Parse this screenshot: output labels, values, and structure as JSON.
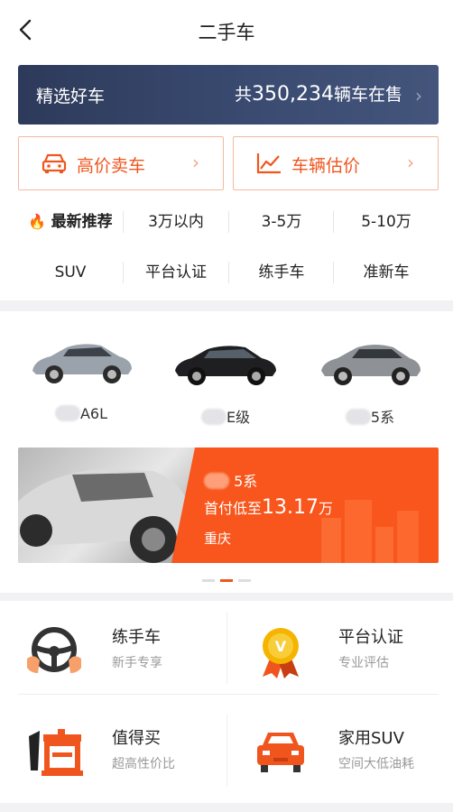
{
  "header": {
    "title": "二手车"
  },
  "banner": {
    "left": "精选好车",
    "prefix": "共",
    "count": "350,234",
    "suffix": "辆车在售"
  },
  "actions": [
    {
      "label": "高价卖车",
      "icon": "car-front-icon"
    },
    {
      "label": "车辆估价",
      "icon": "trend-chart-icon"
    }
  ],
  "filters": {
    "row1": [
      "最新推荐",
      "3万以内",
      "3-5万",
      "5-10万"
    ],
    "row2": [
      "SUV",
      "平台认证",
      "练手车",
      "准新车"
    ]
  },
  "cars": [
    {
      "name": "A6L",
      "icon": "sports-coupe-icon",
      "color": "#9aa3ab"
    },
    {
      "name": "E级",
      "icon": "sedan-icon",
      "color": "#1f1f22"
    },
    {
      "name": "5系",
      "icon": "coupe-icon",
      "color": "#8e9296"
    }
  ],
  "promo": {
    "model": "5系",
    "price_prefix": "首付低至",
    "price": "13.17",
    "unit": "万",
    "city": "重庆",
    "accent": "#f8561c"
  },
  "features": [
    {
      "title": "练手车",
      "sub": "新手专享",
      "icon": "steering-wheel-icon"
    },
    {
      "title": "平台认证",
      "sub": "专业评估",
      "icon": "medal-icon"
    },
    {
      "title": "值得买",
      "sub": "超高性价比",
      "icon": "zhi-icon"
    },
    {
      "title": "家用SUV",
      "sub": "空间大低油耗",
      "icon": "family-car-icon"
    }
  ],
  "colors": {
    "accent": "#f0551e",
    "banner": "#2d3a5a"
  }
}
